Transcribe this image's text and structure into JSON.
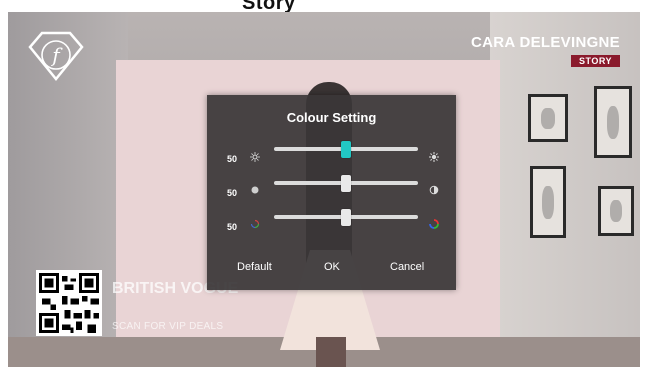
{
  "page": {
    "top_text": "Story",
    "brand_name": "CARA DELEVINGNE",
    "brand_tag": "STORY",
    "promo_title": "BRITISH VOGUE",
    "promo_subtitle": "SCAN FOR VIP DEALS",
    "logo_glyph": "f"
  },
  "dialog": {
    "title": "Colour Setting",
    "sliders": [
      {
        "name": "brightness",
        "value": "50",
        "level": 0.5,
        "icon_left": "sun-small-icon",
        "icon_right": "sun-large-icon",
        "focused": true
      },
      {
        "name": "contrast",
        "value": "50",
        "level": 0.5,
        "icon_left": "contrast-low-icon",
        "icon_right": "contrast-high-icon",
        "focused": false
      },
      {
        "name": "saturation",
        "value": "50",
        "level": 0.5,
        "icon_left": "color-low-icon",
        "icon_right": "color-high-icon",
        "focused": false
      }
    ],
    "buttons": {
      "default": "Default",
      "ok": "OK",
      "cancel": "Cancel"
    },
    "accent_color": "#22c8c4"
  }
}
